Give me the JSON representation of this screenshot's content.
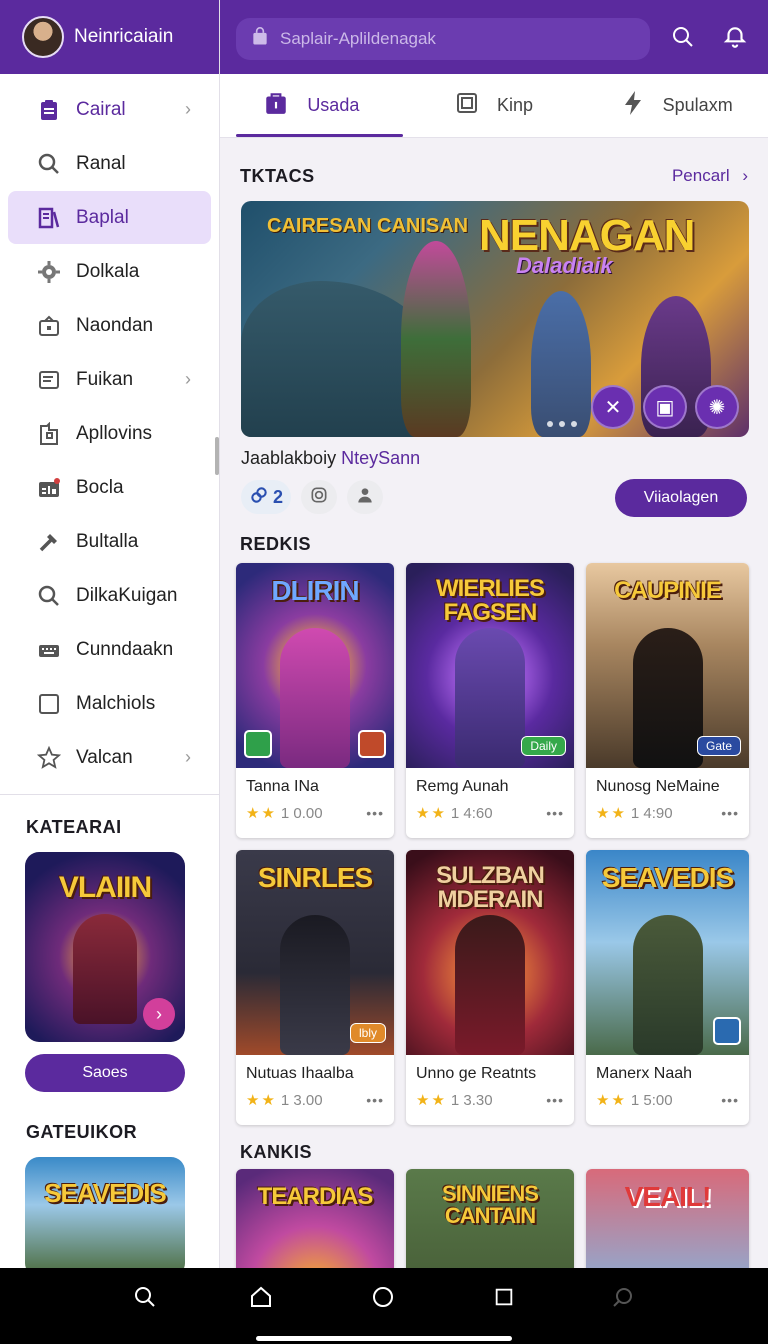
{
  "sidebar": {
    "title": "Neinricaiain",
    "items": [
      {
        "label": "Cairal",
        "icon": "clipboard-icon",
        "chevron": true
      },
      {
        "label": "Ranal",
        "icon": "search-icon",
        "chevron": false
      },
      {
        "label": "Baplal",
        "icon": "library-icon",
        "chevron": false
      },
      {
        "label": "Dolkala",
        "icon": "gear-icon",
        "chevron": false
      },
      {
        "label": "Naondan",
        "icon": "lock-box-icon",
        "chevron": false
      },
      {
        "label": "Fuikan",
        "icon": "list-icon",
        "chevron": true
      },
      {
        "label": "Apllovins",
        "icon": "download-file-icon",
        "chevron": false
      },
      {
        "label": "Bocla",
        "icon": "chart-icon",
        "chevron": false
      },
      {
        "label": "Bultalla",
        "icon": "tools-icon",
        "chevron": false
      },
      {
        "label": "DilkaKuigan",
        "icon": "search-icon",
        "chevron": false
      },
      {
        "label": "Cunndaakn",
        "icon": "keyboard-icon",
        "chevron": false
      },
      {
        "label": "Malchiols",
        "icon": "square-icon",
        "chevron": false
      },
      {
        "label": "Valcan",
        "icon": "star-icon",
        "chevron": true
      }
    ],
    "section1_title": "KATEARAI",
    "card1_title": "VLAIIN",
    "card1_button": "Saoes",
    "section2_title": "GATEUIKOR",
    "card2_title": "SEAVEDIS"
  },
  "header": {
    "search_placeholder": "Saplair-Aplildenagak"
  },
  "tabs": [
    {
      "label": "Usada",
      "icon": "bag-icon"
    },
    {
      "label": "Kinp",
      "icon": "frame-icon"
    },
    {
      "label": "Spulaxm",
      "icon": "bolt-icon"
    }
  ],
  "main": {
    "section_title": "TKTACS",
    "see_all": "Pencarl",
    "hero": {
      "tag": "CAIRESAN CANISAN",
      "title": "NENAGAN",
      "subtitle": "Daladiaik"
    },
    "featured_prefix": "Jaablakboiy",
    "featured_highlight": "NteySann",
    "chip_count": "2",
    "primary_button": "Viiaolagen",
    "section2_title": "REDKIS",
    "section3_title": "KANKIS",
    "games_row1": [
      {
        "art_title": "DLIRIN",
        "name": "Tanna INa",
        "rating": "1 0.00",
        "badge": ""
      },
      {
        "art_title": "WIERLIES FAGSEN",
        "name": "Remg Aunah",
        "rating": "1 4:60",
        "badge": "Daily"
      },
      {
        "art_title": "CAUPINIE",
        "name": "Nunosg NeMaine",
        "rating": "1 4:90",
        "badge": "Gate"
      }
    ],
    "games_row2": [
      {
        "art_title": "SINRLES",
        "name": "Nutuas Ihaalba",
        "rating": "1 3.00",
        "badge": "lbly"
      },
      {
        "art_title": "SULZBAN MDERAIN",
        "name": "Unno ge Reatnts",
        "rating": "1 3.30",
        "badge": ""
      },
      {
        "art_title": "SEAVEDIS",
        "name": "Manerx Naah",
        "rating": "1 5:00",
        "badge": ""
      }
    ],
    "games_row3": [
      {
        "art_title": "TEARDIAS"
      },
      {
        "art_title": "SINNIENS CANTAIN"
      },
      {
        "art_title": "VEAIL!"
      }
    ]
  },
  "colors": {
    "brand": "#5b2a9e",
    "accent_pink": "#d23f9b",
    "star": "#f2b318"
  }
}
